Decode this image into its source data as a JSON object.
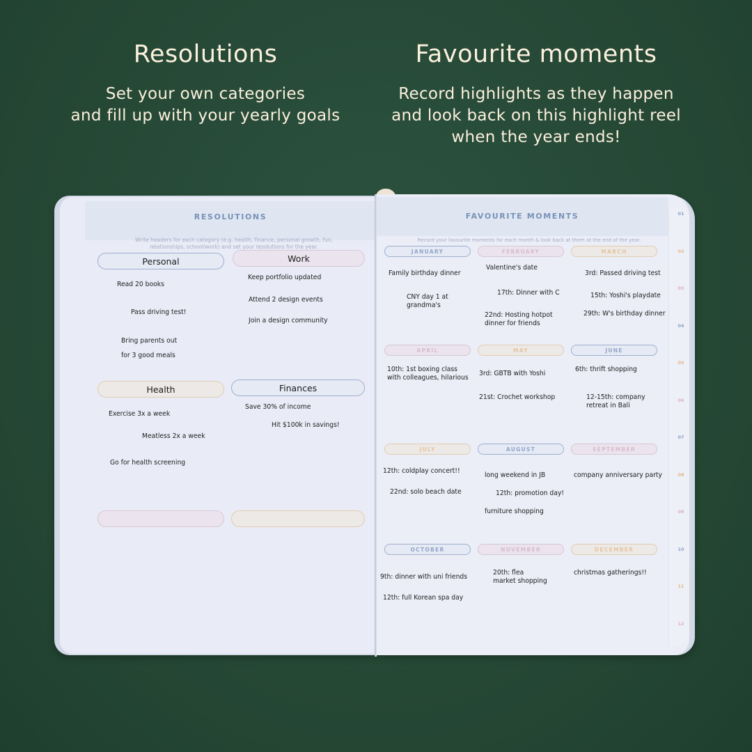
{
  "captions": {
    "left": {
      "title": "Resolutions",
      "subtitle_lines": [
        "Set your own categories",
        "and fill up with your yearly goals"
      ]
    },
    "right": {
      "title": "Favourite moments",
      "subtitle_lines": [
        "Record highlights as they happen",
        "and look back on this highlight reel",
        "when the year ends!"
      ]
    }
  },
  "colors": {
    "background": "#264a36",
    "caption_text": "#fbf0dd",
    "page": "#e9ebf6",
    "title_blue": "#7891b8",
    "pill_blue": "#9fb0cd",
    "pill_pink": "#d6c7d5",
    "pill_peach": "#e0ceb2"
  },
  "resolutions_page": {
    "title": "RESOLUTIONS",
    "instruction_lines": [
      "Write headers for each category (e.g. health, finance, personal growth, fun,",
      "relationships, school/work) and set your resolutions for the year."
    ],
    "categories": [
      {
        "header": "Personal",
        "color": "blue",
        "items": [
          "Read 20 books",
          "Pass driving test!",
          "Bring parents out\nfor 3 good meals"
        ]
      },
      {
        "header": "Work",
        "color": "pink",
        "items": [
          "Keep portfolio updated",
          "Attend 2 design events",
          "Join a design community"
        ]
      },
      {
        "header": "Health",
        "color": "peach",
        "items": [
          "Exercise 3x a week",
          "Meatless 2x a week",
          "Go for health screening"
        ]
      },
      {
        "header": "Finances",
        "color": "blue",
        "items": [
          "Save 30% of income",
          "Hit $100k in savings!"
        ]
      },
      {
        "header": "",
        "color": "pink",
        "items": []
      },
      {
        "header": "",
        "color": "peach",
        "items": []
      }
    ]
  },
  "moments_page": {
    "title": "FAVOURITE MOMENTS",
    "instruction": "Record your favourite moments for each month & look back at them at the end of the year.",
    "months": [
      {
        "name": "JANUARY",
        "color": "blue",
        "entries": [
          "Family birthday dinner",
          "CNY day 1 at\ngrandma's"
        ]
      },
      {
        "name": "FEBRUARY",
        "color": "pink",
        "entries": [
          "Valentine's date",
          "17th: Dinner with C",
          "22nd: Hosting hotpot\ndinner for friends"
        ]
      },
      {
        "name": "MARCH",
        "color": "peach",
        "entries": [
          "3rd: Passed driving test",
          "15th: Yoshi's playdate",
          "29th: W's birthday dinner"
        ]
      },
      {
        "name": "APRIL",
        "color": "pink",
        "entries": [
          "10th: 1st boxing class\nwith colleagues, hilarious"
        ]
      },
      {
        "name": "MAY",
        "color": "peach",
        "entries": [
          "3rd: GBTB with Yoshi",
          "21st: Crochet workshop"
        ]
      },
      {
        "name": "JUNE",
        "color": "blue",
        "entries": [
          "6th: thrift shopping",
          "12-15th: company\nretreat in Bali"
        ]
      },
      {
        "name": "JULY",
        "color": "peach",
        "entries": [
          "12th: coldplay concert!!",
          "22nd: solo beach date"
        ]
      },
      {
        "name": "AUGUST",
        "color": "blue",
        "entries": [
          "long weekend in JB",
          "12th: promotion day!",
          "furniture shopping"
        ]
      },
      {
        "name": "SEPTEMBER",
        "color": "pink",
        "entries": [
          "company anniversary party"
        ]
      },
      {
        "name": "OCTOBER",
        "color": "blue",
        "entries": [
          "9th: dinner with uni friends",
          "12th: full Korean spa day"
        ]
      },
      {
        "name": "NOVEMBER",
        "color": "pink",
        "entries": [
          "20th: flea\nmarket shopping"
        ]
      },
      {
        "name": "DECEMBER",
        "color": "peach",
        "entries": [
          "christmas gatherings!!"
        ]
      }
    ],
    "month_tabs": [
      {
        "label": "01",
        "color": "blue"
      },
      {
        "label": "02",
        "color": "peach"
      },
      {
        "label": "03",
        "color": "pink"
      },
      {
        "label": "04",
        "color": "blue"
      },
      {
        "label": "05",
        "color": "peach"
      },
      {
        "label": "06",
        "color": "pink"
      },
      {
        "label": "07",
        "color": "blue"
      },
      {
        "label": "08",
        "color": "peach"
      },
      {
        "label": "09",
        "color": "pink"
      },
      {
        "label": "10",
        "color": "blue"
      },
      {
        "label": "11",
        "color": "peach"
      },
      {
        "label": "12",
        "color": "pink"
      }
    ]
  }
}
